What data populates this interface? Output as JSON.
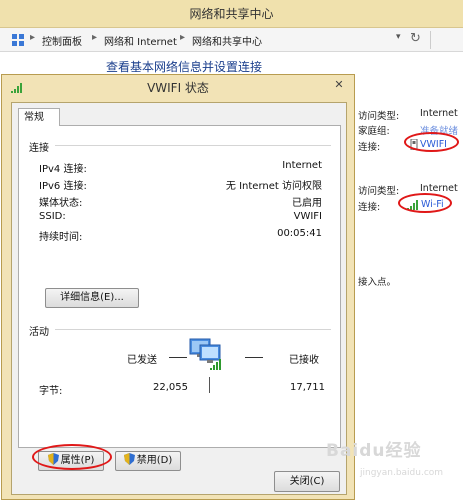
{
  "background_window": {
    "title": "网络和共享中心",
    "breadcrumb": [
      "控制面板",
      "网络和 Internet",
      "网络和共享中心"
    ],
    "breadcrumb_sep": "▸",
    "heading": "查看基本网络信息并设置连接",
    "network1": {
      "access_type_label": "访问类型:",
      "access_type_value": "Internet",
      "homegroup_label": "家庭组:",
      "homegroup_value": "准备就绪",
      "connection_label": "连接:",
      "connection_value": "VWIFI"
    },
    "network2": {
      "access_type_label": "访问类型:",
      "access_type_value": "Internet",
      "connection_label": "连接:",
      "connection_value": "Wi-Fi"
    },
    "partial_text": "接入点。"
  },
  "dialog": {
    "title": "VWIFI 状态",
    "close_glyph": "✕",
    "tab_label": "常规",
    "connection_group": {
      "heading": "连接",
      "rows": [
        {
          "label": "IPv4 连接:",
          "value": "Internet"
        },
        {
          "label": "IPv6 连接:",
          "value": "无 Internet 访问权限"
        },
        {
          "label": "媒体状态:",
          "value": "已启用"
        },
        {
          "label": "SSID:",
          "value": "VWIFI"
        },
        {
          "label": "持续时间:",
          "value": "00:05:41"
        }
      ]
    },
    "details_button": "详细信息(E)...",
    "activity_group": {
      "heading": "活动",
      "sent_label": "已发送",
      "received_label": "已接收",
      "bytes_label": "字节:",
      "bytes_sent": "22,055",
      "bytes_received": "17,711"
    },
    "properties_button": "属性(P)",
    "disable_button": "禁用(D)",
    "close_button": "关闭(C)"
  },
  "watermark": {
    "text": "Baidu经验",
    "sub": "jingyan.baidu.com"
  },
  "colors": {
    "title_bar": "#f0e1ad",
    "link": "#2a5bd7",
    "annotation": "#e01818"
  }
}
